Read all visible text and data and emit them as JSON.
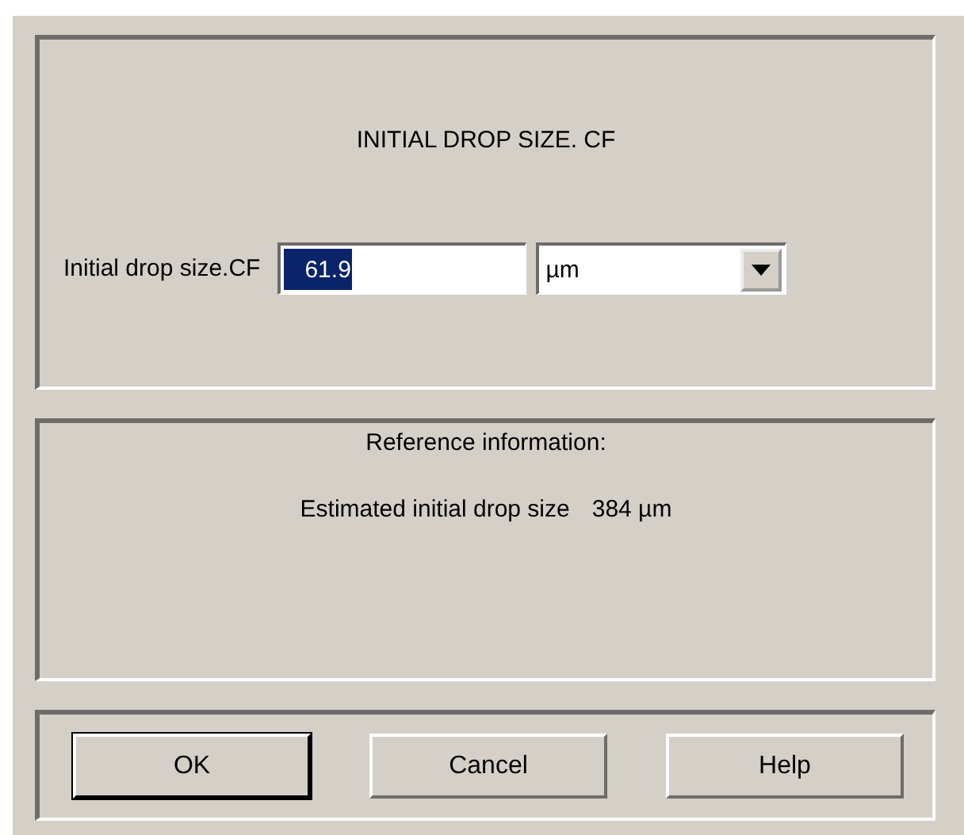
{
  "input_panel": {
    "title": "INITIAL DROP SIZE. CF",
    "field": {
      "label": "Initial drop size.CF",
      "value": "61.9",
      "value_selected": true
    },
    "unit_dropdown": {
      "value": "µm"
    }
  },
  "reference_panel": {
    "heading": "Reference information:",
    "estimate": {
      "label": "Estimated initial drop size",
      "value": "384 µm"
    }
  },
  "buttons": [
    {
      "label": "OK",
      "default": true
    },
    {
      "label": "Cancel",
      "default": false
    },
    {
      "label": "Help",
      "default": false
    }
  ]
}
